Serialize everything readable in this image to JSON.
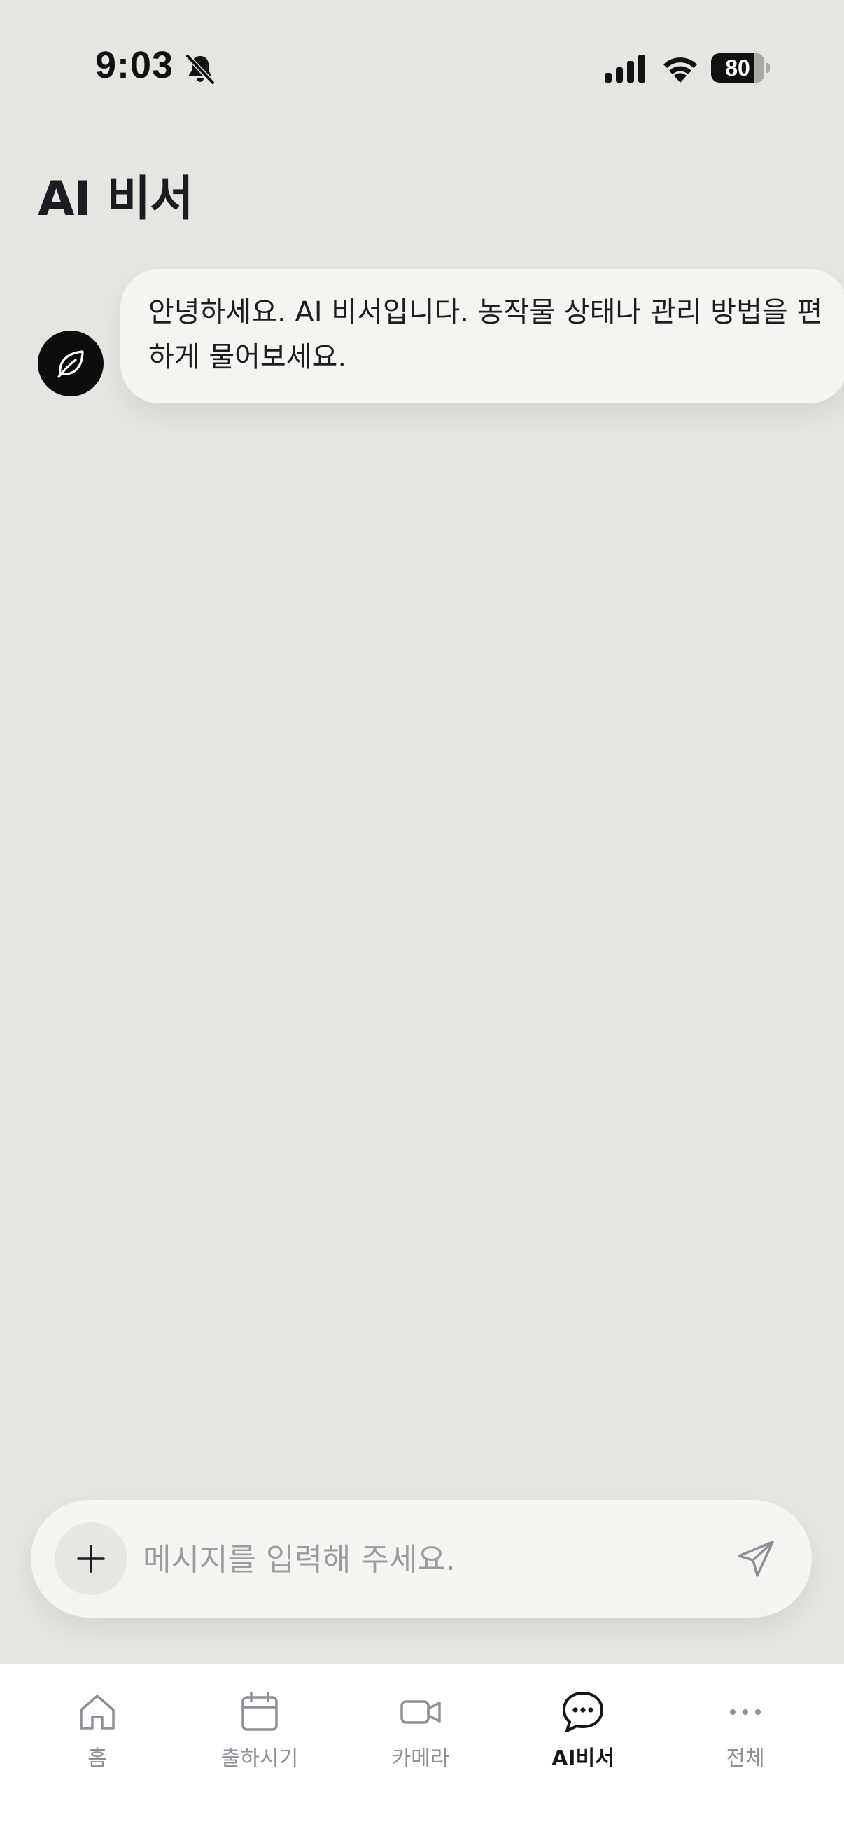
{
  "status_bar": {
    "time": "9:03",
    "battery_level": "80",
    "battery_fraction": 0.8,
    "icons": [
      "bell-off-icon",
      "signal-icon",
      "wifi-icon",
      "battery-icon"
    ]
  },
  "header": {
    "title": "AI 비서"
  },
  "chat": {
    "messages": [
      {
        "sender": "bot",
        "avatar_icon": "leaf-icon",
        "text": "안녕하세요. AI 비서입니다. 농작물 상태나 관리 방법을 편하게 물어보세요."
      }
    ]
  },
  "composer": {
    "add_icon": "plus-icon",
    "placeholder": "메시지를 입력해 주세요.",
    "value": "",
    "send_icon": "send-icon"
  },
  "bottom_nav": {
    "items": [
      {
        "label": "홈",
        "icon": "home-icon",
        "active": false
      },
      {
        "label": "출하시기",
        "icon": "calendar-icon",
        "active": false
      },
      {
        "label": "카메라",
        "icon": "video-camera-icon",
        "active": false
      },
      {
        "label": "AI비서",
        "icon": "chat-bubble-icon",
        "active": true
      },
      {
        "label": "전체",
        "icon": "more-icon",
        "active": false
      }
    ]
  },
  "colors": {
    "background": "#e6e5e1",
    "bubble": "#f5f4f1",
    "text": "#1b1d22",
    "nav_inactive": "#8e9097",
    "nav_active": "#14161b"
  }
}
